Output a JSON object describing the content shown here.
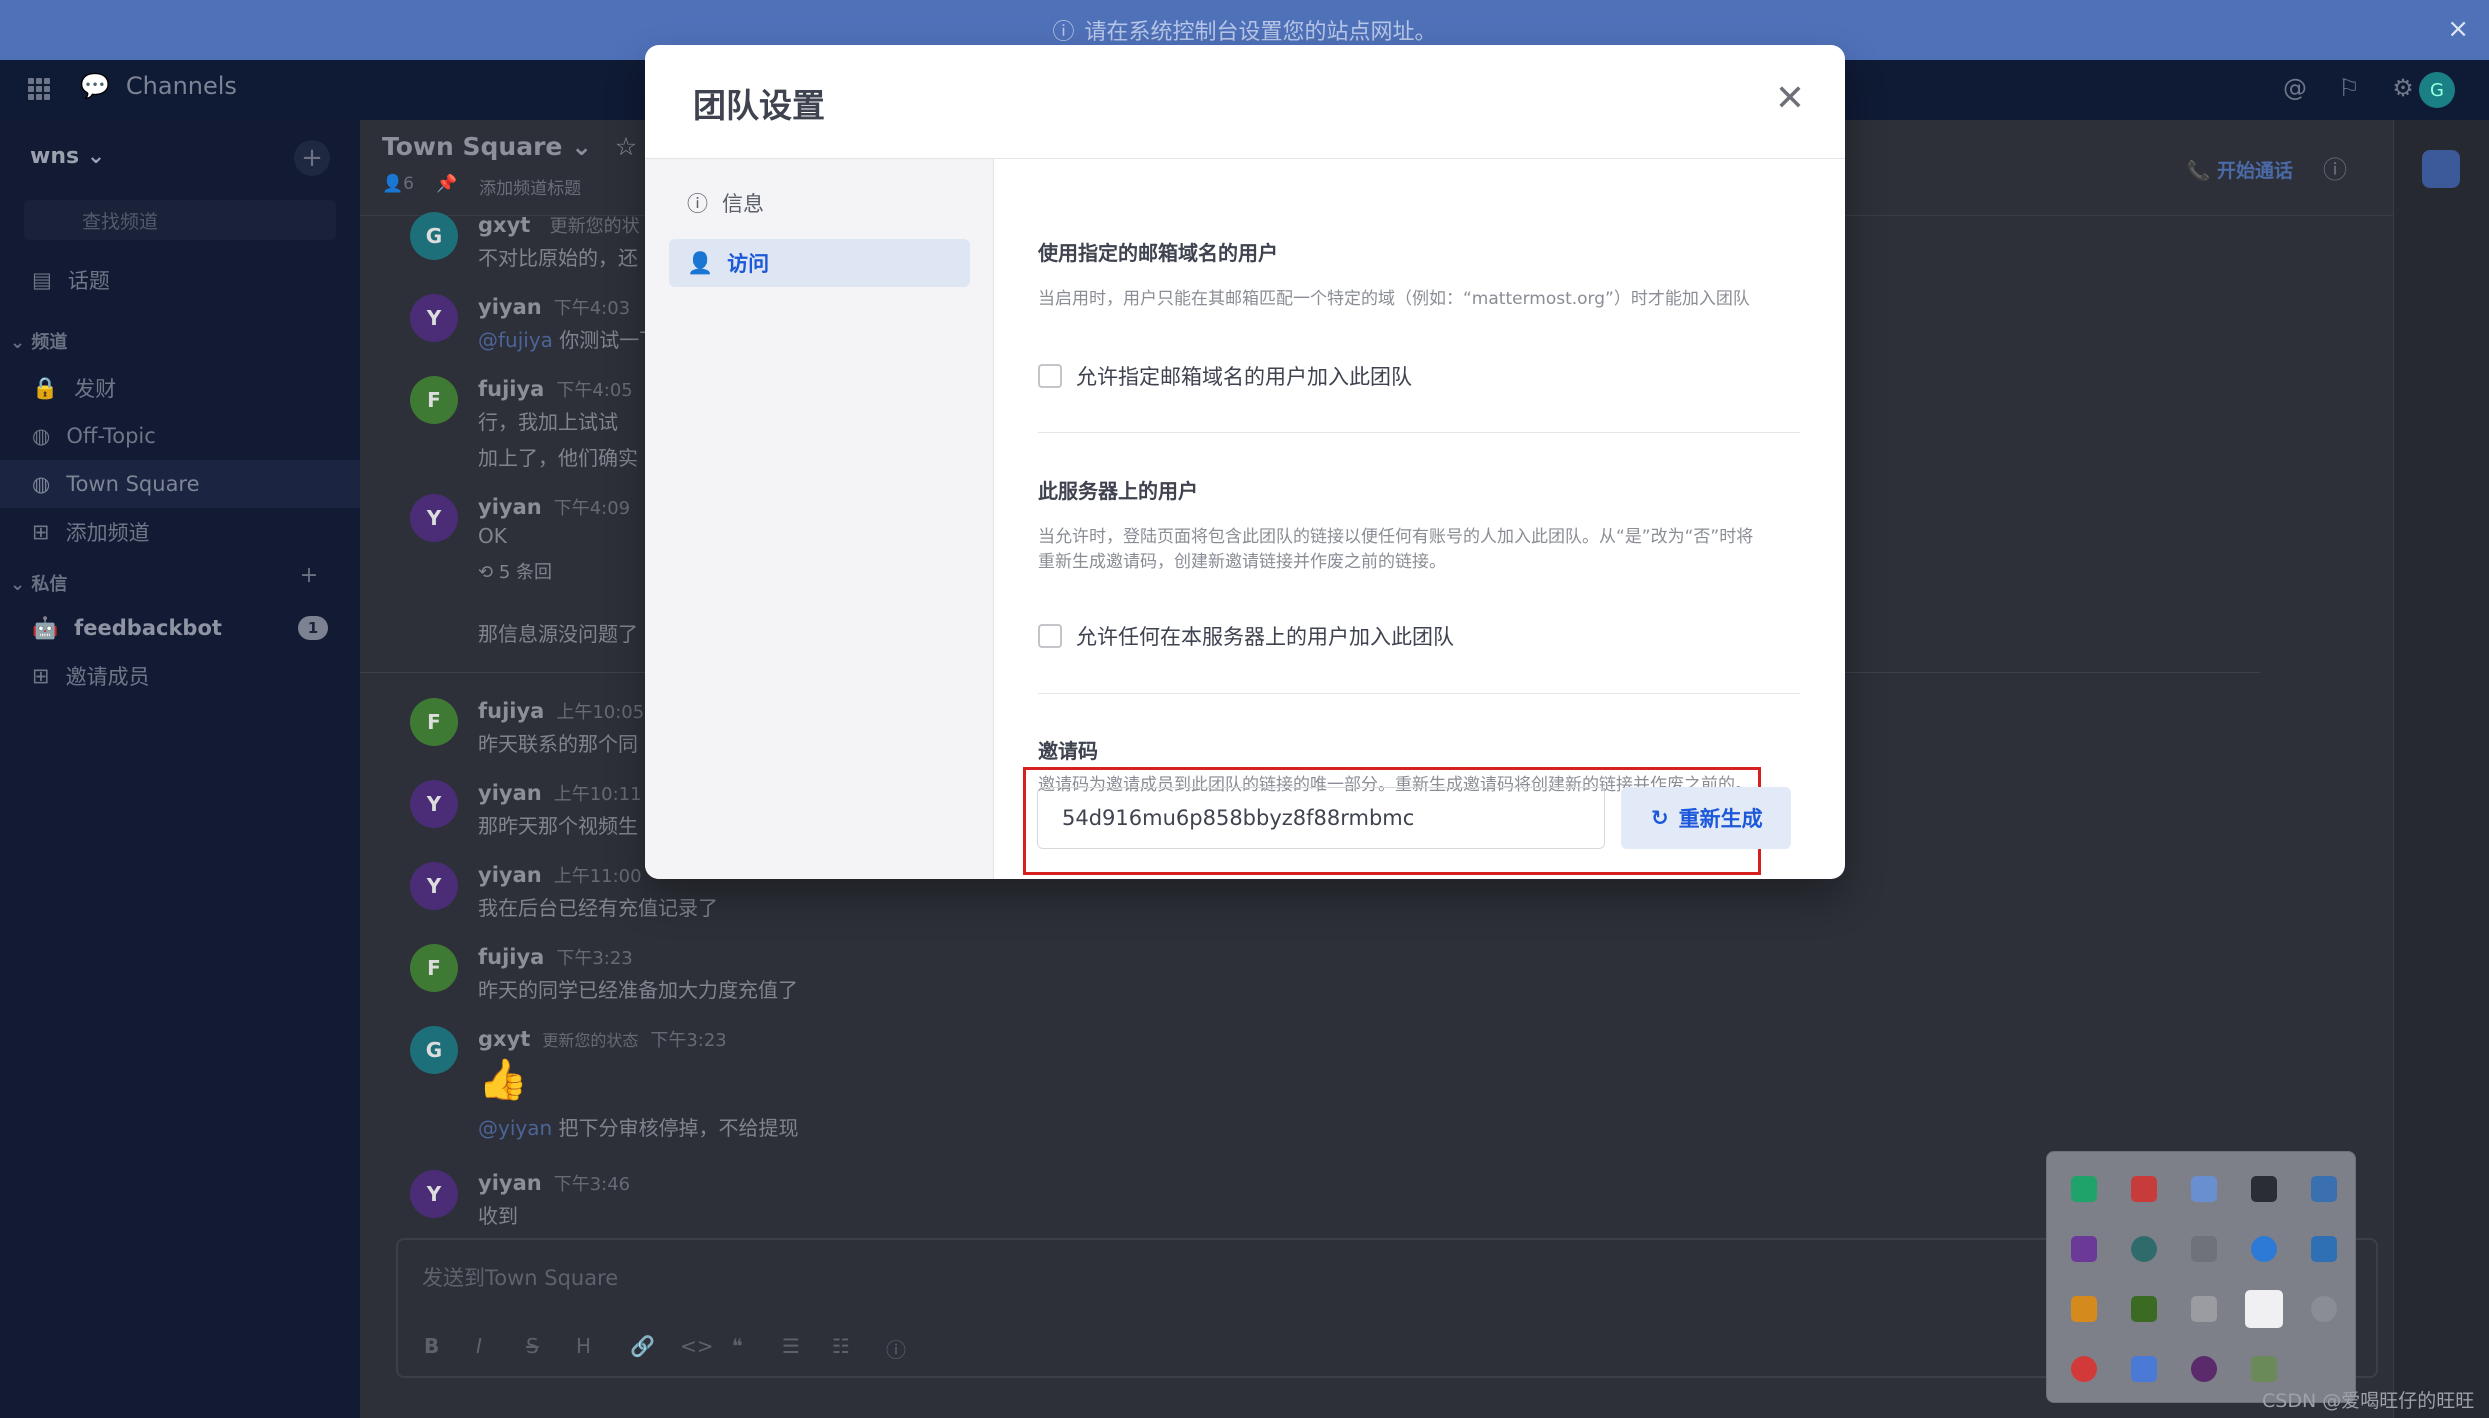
{
  "announcement": {
    "text": "请在系统控制台设置您的站点网址。",
    "close": "×"
  },
  "global_header": {
    "product": "Channels",
    "avatar_letter": "G"
  },
  "sidebar": {
    "team_name": "wns ⌄",
    "search_placeholder": "查找频道",
    "threads": "话题",
    "channels_label": "频道",
    "channels": [
      {
        "icon": "lock-icon",
        "label": "发财"
      },
      {
        "icon": "globe-icon",
        "label": "Off-Topic"
      },
      {
        "icon": "globe-icon",
        "label": "Town Square"
      },
      {
        "icon": "plus-square-icon",
        "label": "添加频道"
      }
    ],
    "dm_label": "私信",
    "dms": [
      {
        "label": "feedbackbot",
        "badge": "1"
      },
      {
        "label": "邀请成员"
      }
    ]
  },
  "channel": {
    "title": "Town Square ⌄",
    "member_count": "6",
    "header_hint": "添加频道标题",
    "start_call": "开始通话",
    "messages": [
      {
        "avatar": "G",
        "name": "gxyt",
        "time": "更新您的状",
        "text": "不对比原始的，还"
      },
      {
        "avatar": "Y",
        "name": "yiyan",
        "time": "下午4:03",
        "mention": "@fujiya",
        "text": " 你测试一下"
      },
      {
        "avatar": "F",
        "name": "fujiya",
        "time": "下午4:05",
        "text": "行，我加上试试",
        "text2": "加上了，他们确实"
      },
      {
        "avatar": "Y",
        "name": "yiyan",
        "time": "下午4:09",
        "text": "OK",
        "reply": "5 条回",
        "text2": "那信息源没问题了"
      },
      {
        "avatar": "F",
        "name": "fujiya",
        "time": "上午10:05",
        "text": "昨天联系的那个同"
      },
      {
        "avatar": "Y",
        "name": "yiyan",
        "time": "上午10:11",
        "text": "那昨天那个视频生"
      },
      {
        "avatar": "Y",
        "name": "yiyan",
        "time": "上午11:00",
        "text": "我在后台已经有充值记录了"
      },
      {
        "avatar": "F",
        "name": "fujiya",
        "time": "下午3:23",
        "text": "昨天的同学已经准备加大力度充值了"
      },
      {
        "avatar": "G",
        "name": "gxyt",
        "status": "更新您的状态",
        "time": "下午3:23",
        "emoji": "👍",
        "mention": "@yiyan",
        "text": " 把下分审核停掉，不给提现"
      },
      {
        "avatar": "Y",
        "name": "yiyan",
        "time": "下午3:46",
        "text": "收到"
      }
    ],
    "composer_placeholder": "发送到Town Square",
    "format_buttons": [
      "B",
      "I",
      "S",
      "H",
      "🔗",
      "<>",
      "❝",
      "☰",
      "☷",
      "ⓘ"
    ]
  },
  "modal": {
    "title": "团队设置",
    "close": "✕",
    "nav": [
      {
        "label": "信息",
        "icon": "info-icon"
      },
      {
        "label": "访问",
        "icon": "user-icon"
      }
    ],
    "sections": {
      "email_domain": {
        "title": "使用指定的邮箱域名的用户",
        "desc": "当启用时，用户只能在其邮箱匹配一个特定的域（例如：“mattermost.org”）时才能加入团队",
        "checkbox": "允许指定邮箱域名的用户加入此团队"
      },
      "server_users": {
        "title": "此服务器上的用户",
        "desc1": "当允许时，登陆页面将包含此团队的链接以便任何有账号的人加入此团队。从“是”改为“否”时将",
        "desc2": "重新生成邀请码，创建新邀请链接并作废之前的链接。",
        "checkbox": "允许任何在本服务器上的用户加入此团队"
      },
      "invite": {
        "title": "邀请码",
        "desc": "邀请码为邀请成员到此团队的链接的唯一部分。重新生成邀请码将创建新的链接并作废之前的。",
        "code": "54d916mu6p858bbyz8f88rmbmc",
        "regenerate": "重新生成"
      }
    }
  },
  "watermark": "CSDN @爱喝旺仔的旺旺"
}
